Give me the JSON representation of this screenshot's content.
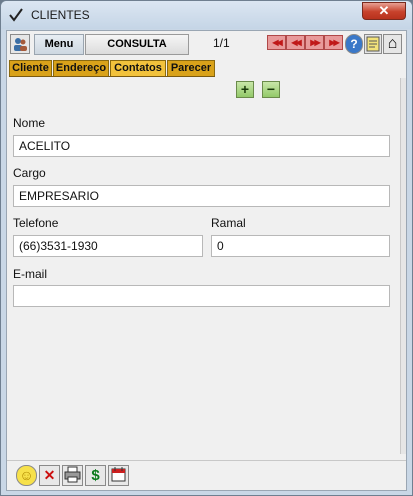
{
  "window": {
    "title": "CLIENTES",
    "close_label": "✕"
  },
  "toolbar": {
    "menu_label": "Menu",
    "consulta_label": "CONSULTA",
    "pager": "1/1",
    "nav": [
      "first-icon",
      "prev-icon",
      "next-icon",
      "last-icon"
    ],
    "nav_glyphs": [
      "◀◀",
      "◀◀",
      "▶▶",
      "▶▶"
    ],
    "tools": [
      "help-icon",
      "notes-icon",
      "home-icon"
    ],
    "help_glyph": "?",
    "home_glyph": "⌂"
  },
  "tabs": [
    "Cliente",
    "Endereço",
    "Contatos",
    "Parecer"
  ],
  "active_tab": "Contatos",
  "record_actions": {
    "add_glyph": "+",
    "remove_glyph": "−"
  },
  "form": {
    "nome_label": "Nome",
    "nome_value": "ACELITO",
    "cargo_label": "Cargo",
    "cargo_value": "EMPRESARIO",
    "telefone_label": "Telefone",
    "telefone_value": "(66)3531-1930",
    "ramal_label": "Ramal",
    "ramal_value": "0",
    "email_label": "E-mail",
    "email_value": ""
  },
  "bottom_toolbar": {
    "icons": [
      "smiley-icon",
      "delete-icon",
      "print-icon",
      "dollar-icon",
      "calendar-icon"
    ],
    "smiley_glyph": "☺",
    "delete_glyph": "✕",
    "dollar_glyph": "$"
  },
  "colors": {
    "tab_bg": "#d9a21a",
    "tab_active_bg": "#f2c23c",
    "nav_red": "#c01818",
    "add_green": "#93c96a"
  }
}
